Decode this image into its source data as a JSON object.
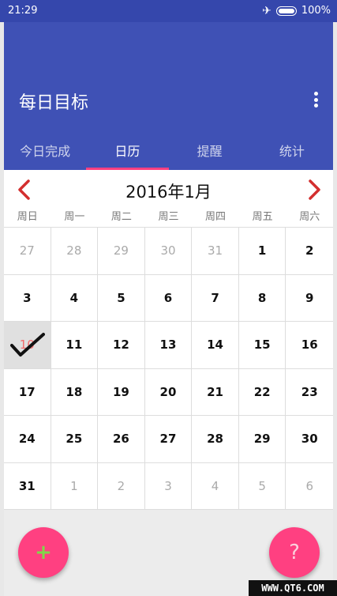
{
  "status_bar": {
    "time": "21:29",
    "battery": "100%",
    "airplane_icon": "airplane-icon",
    "battery_icon": "battery-icon"
  },
  "app": {
    "title": "每日目标",
    "menu_icon": "more-vert-icon"
  },
  "tabs": [
    {
      "label": "今日完成",
      "active": false
    },
    {
      "label": "日历",
      "active": true
    },
    {
      "label": "提醒",
      "active": false
    },
    {
      "label": "统计",
      "active": false
    }
  ],
  "calendar": {
    "month_title": "2016年1月",
    "prev_icon": "chevron-left-icon",
    "next_icon": "chevron-right-icon",
    "weekdays": [
      "周日",
      "周一",
      "周二",
      "周三",
      "周四",
      "周五",
      "周六"
    ],
    "days": [
      {
        "label": "27",
        "muted": true
      },
      {
        "label": "28",
        "muted": true
      },
      {
        "label": "29",
        "muted": true
      },
      {
        "label": "30",
        "muted": true
      },
      {
        "label": "31",
        "muted": true
      },
      {
        "label": "1"
      },
      {
        "label": "2"
      },
      {
        "label": "3"
      },
      {
        "label": "4"
      },
      {
        "label": "5"
      },
      {
        "label": "6"
      },
      {
        "label": "7"
      },
      {
        "label": "8"
      },
      {
        "label": "9"
      },
      {
        "label": "10",
        "done": true
      },
      {
        "label": "11"
      },
      {
        "label": "12"
      },
      {
        "label": "13"
      },
      {
        "label": "14"
      },
      {
        "label": "15"
      },
      {
        "label": "16"
      },
      {
        "label": "17"
      },
      {
        "label": "18"
      },
      {
        "label": "19"
      },
      {
        "label": "20"
      },
      {
        "label": "21"
      },
      {
        "label": "22"
      },
      {
        "label": "23"
      },
      {
        "label": "24"
      },
      {
        "label": "25"
      },
      {
        "label": "26"
      },
      {
        "label": "27"
      },
      {
        "label": "28"
      },
      {
        "label": "29"
      },
      {
        "label": "30"
      },
      {
        "label": "31"
      },
      {
        "label": "1",
        "muted": true
      },
      {
        "label": "2",
        "muted": true
      },
      {
        "label": "3",
        "muted": true
      },
      {
        "label": "4",
        "muted": true
      },
      {
        "label": "5",
        "muted": true
      },
      {
        "label": "6",
        "muted": true
      }
    ]
  },
  "fab": {
    "add_label": "+",
    "help_label": "?"
  },
  "watermark": "WWW.QT6.COM",
  "colors": {
    "primary": "#3f51b5",
    "accent": "#ff4081",
    "nav_arrow": "#d32f2f"
  }
}
